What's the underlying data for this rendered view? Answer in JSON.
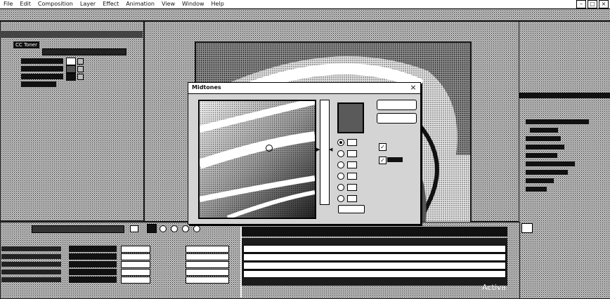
{
  "menu": {
    "items": [
      {
        "label": "File"
      },
      {
        "label": "Edit"
      },
      {
        "label": "Composition"
      },
      {
        "label": "Layer"
      },
      {
        "label": "Effect"
      },
      {
        "label": "Animation"
      },
      {
        "label": "View"
      },
      {
        "label": "Window"
      },
      {
        "label": "Help"
      }
    ],
    "minimize_icon": "minimize-icon",
    "restore_icon": "restore-icon",
    "close_icon": "close-icon"
  },
  "effect_controls": {
    "effect_name": "CC Toner"
  },
  "dialog": {
    "title": "Midtones",
    "close_glyph": "×"
  },
  "watermark": {
    "text": "Activa"
  },
  "colors": {
    "panel": "#c4c4c4",
    "dark": "#111111",
    "dialog": "#d4d4d4"
  }
}
